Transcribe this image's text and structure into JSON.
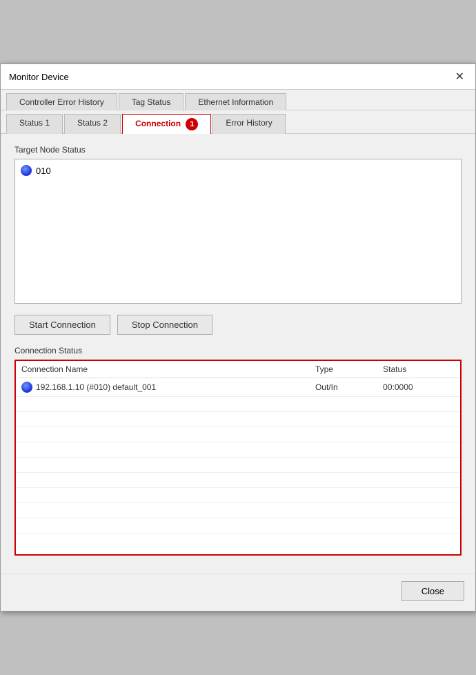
{
  "window": {
    "title": "Monitor Device",
    "close_label": "✕"
  },
  "tabs_upper": [
    {
      "label": "Controller Error History",
      "id": "ctrl-error",
      "active": false
    },
    {
      "label": "Tag Status",
      "id": "tag-status",
      "active": false
    },
    {
      "label": "Ethernet Information",
      "id": "ethernet-info",
      "active": false
    }
  ],
  "tabs_lower": [
    {
      "label": "Status 1",
      "id": "status1",
      "active": false
    },
    {
      "label": "Status 2",
      "id": "status2",
      "active": false
    },
    {
      "label": "Connection",
      "id": "connection",
      "active": true,
      "badge": "1"
    },
    {
      "label": "Error History",
      "id": "error-history",
      "active": false
    }
  ],
  "target_node_status": {
    "label": "Target Node Status",
    "nodes": [
      {
        "id": "node1",
        "icon": "blue-circle",
        "label": "010"
      }
    ]
  },
  "buttons": {
    "start_connection": "Start Connection",
    "stop_connection": "Stop Connection"
  },
  "connection_status": {
    "label": "Connection Status",
    "columns": [
      "Connection Name",
      "Type",
      "Status"
    ],
    "rows": [
      {
        "name": "192.168.1.10 (#010) default_001",
        "type": "Out/In",
        "status": "00:0000"
      }
    ]
  },
  "footer": {
    "close_label": "Close"
  }
}
